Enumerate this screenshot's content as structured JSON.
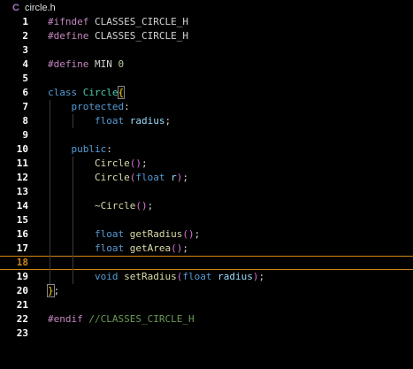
{
  "tab": {
    "icon": "C",
    "filename": "circle.h"
  },
  "lines": [
    {
      "n": "1",
      "tokens": [
        [
          "pp",
          "#ifndef"
        ],
        [
          "plain",
          " CLASSES_CIRCLE_H"
        ]
      ]
    },
    {
      "n": "2",
      "tokens": [
        [
          "pp",
          "#define"
        ],
        [
          "plain",
          " CLASSES_CIRCLE_H"
        ]
      ]
    },
    {
      "n": "3",
      "tokens": []
    },
    {
      "n": "4",
      "tokens": [
        [
          "pp",
          "#define"
        ],
        [
          "plain",
          " MIN "
        ],
        [
          "nm",
          "0"
        ]
      ]
    },
    {
      "n": "5",
      "tokens": []
    },
    {
      "n": "6",
      "tokens": [
        [
          "kw",
          "class"
        ],
        [
          "plain",
          " "
        ],
        [
          "ty",
          "Circle"
        ],
        [
          "br1m",
          "{"
        ]
      ]
    },
    {
      "n": "7",
      "indent": 1,
      "tokens": [
        [
          "plain",
          "    "
        ],
        [
          "kw",
          "protected"
        ],
        [
          "plain",
          ":"
        ]
      ]
    },
    {
      "n": "8",
      "indent": 2,
      "tokens": [
        [
          "plain",
          "        "
        ],
        [
          "kw",
          "float"
        ],
        [
          "plain",
          " "
        ],
        [
          "pm",
          "radius"
        ],
        [
          "plain",
          ";"
        ]
      ]
    },
    {
      "n": "9",
      "indent": 1,
      "tokens": []
    },
    {
      "n": "10",
      "indent": 1,
      "tokens": [
        [
          "plain",
          "    "
        ],
        [
          "kw",
          "public"
        ],
        [
          "plain",
          ":"
        ]
      ]
    },
    {
      "n": "11",
      "indent": 2,
      "tokens": [
        [
          "plain",
          "        "
        ],
        [
          "fn",
          "Circle"
        ],
        [
          "br2",
          "()"
        ],
        [
          "plain",
          ";"
        ]
      ]
    },
    {
      "n": "12",
      "indent": 2,
      "tokens": [
        [
          "plain",
          "        "
        ],
        [
          "fn",
          "Circle"
        ],
        [
          "br2",
          "("
        ],
        [
          "kw",
          "float"
        ],
        [
          "plain",
          " "
        ],
        [
          "pm",
          "r"
        ],
        [
          "br2",
          ")"
        ],
        [
          "plain",
          ";"
        ]
      ]
    },
    {
      "n": "13",
      "indent": 2,
      "tokens": []
    },
    {
      "n": "14",
      "indent": 2,
      "tokens": [
        [
          "plain",
          "        "
        ],
        [
          "fn",
          "~Circle"
        ],
        [
          "br2",
          "()"
        ],
        [
          "plain",
          ";"
        ]
      ]
    },
    {
      "n": "15",
      "indent": 2,
      "tokens": []
    },
    {
      "n": "16",
      "indent": 2,
      "tokens": [
        [
          "plain",
          "        "
        ],
        [
          "kw",
          "float"
        ],
        [
          "plain",
          " "
        ],
        [
          "fn",
          "getRadius"
        ],
        [
          "br2",
          "()"
        ],
        [
          "plain",
          ";"
        ]
      ]
    },
    {
      "n": "17",
      "indent": 2,
      "tokens": [
        [
          "plain",
          "        "
        ],
        [
          "kw",
          "float"
        ],
        [
          "plain",
          " "
        ],
        [
          "fn",
          "getArea"
        ],
        [
          "br2",
          "()"
        ],
        [
          "plain",
          ";"
        ]
      ]
    },
    {
      "n": "18",
      "indent": 2,
      "current": true,
      "tokens": []
    },
    {
      "n": "19",
      "indent": 2,
      "tokens": [
        [
          "plain",
          "        "
        ],
        [
          "kw",
          "void"
        ],
        [
          "plain",
          " "
        ],
        [
          "fn",
          "setRadius"
        ],
        [
          "br2",
          "("
        ],
        [
          "kw",
          "float"
        ],
        [
          "plain",
          " "
        ],
        [
          "pm",
          "radius"
        ],
        [
          "br2",
          ")"
        ],
        [
          "plain",
          ";"
        ]
      ]
    },
    {
      "n": "20",
      "tokens": [
        [
          "br1m",
          "}"
        ],
        [
          "plain",
          ";"
        ]
      ]
    },
    {
      "n": "21",
      "tokens": []
    },
    {
      "n": "22",
      "tokens": [
        [
          "pp",
          "#endif"
        ],
        [
          "plain",
          " "
        ],
        [
          "cm",
          "//CLASSES_CIRCLE_H"
        ]
      ]
    },
    {
      "n": "23",
      "tokens": []
    }
  ]
}
